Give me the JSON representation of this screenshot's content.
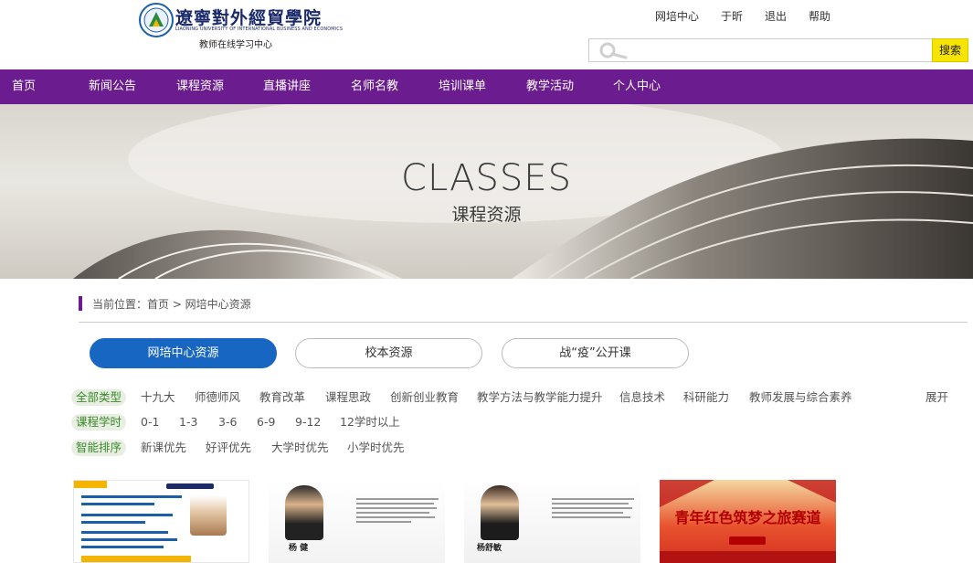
{
  "header": {
    "logo_cn": "遼寧對外經貿學院",
    "logo_en": "LIAONING UNIVERSITY OF INTERNATIONAL BUSINESS AND ECONOMICS",
    "subtitle": "教师在线学习中心",
    "links": [
      "网培中心",
      "于昕",
      "退出",
      "帮助"
    ],
    "search": {
      "placeholder": "",
      "button_label": "搜索"
    }
  },
  "nav": {
    "items": [
      "首页",
      "新闻公告",
      "课程资源",
      "直播讲座",
      "名师名教",
      "培训课单",
      "教学活动",
      "个人中心"
    ],
    "bg_color": "#6b1c8f"
  },
  "banner": {
    "title": "CLASSES",
    "subtitle": "课程资源"
  },
  "breadcrumb": "当前位置：首页 > 网培中心资源",
  "tabs": [
    {
      "label": "网培中心资源",
      "active": true
    },
    {
      "label": "校本资源",
      "active": false
    },
    {
      "label": "战“疫”公开课",
      "active": false
    }
  ],
  "filters": {
    "type": {
      "label": "全部类型",
      "options": [
        "十九大",
        "师德师风",
        "教育改革",
        "课程思政",
        "创新创业教育",
        "教学方法与教学能力提升",
        "信息技术",
        "科研能力",
        "教师发展与综合素养"
      ]
    },
    "hours": {
      "label": "课程学时",
      "options": [
        "0-1",
        "1-3",
        "3-6",
        "6-9",
        "9-12",
        "12学时以上"
      ]
    },
    "sort": {
      "label": "智能排序",
      "options": [
        "新课优先",
        "好评优先",
        "大学时优先",
        "小学时优先"
      ]
    },
    "expand_label": "展开"
  },
  "cards": [
    {
      "thumb": "lecture-slide"
    },
    {
      "thumb": "teacher-portrait",
      "name": "杨 健"
    },
    {
      "thumb": "teacher-portrait",
      "name": "杨舒敏"
    },
    {
      "thumb": "red-poster",
      "title": "青年红色筑梦之旅赛道"
    }
  ]
}
